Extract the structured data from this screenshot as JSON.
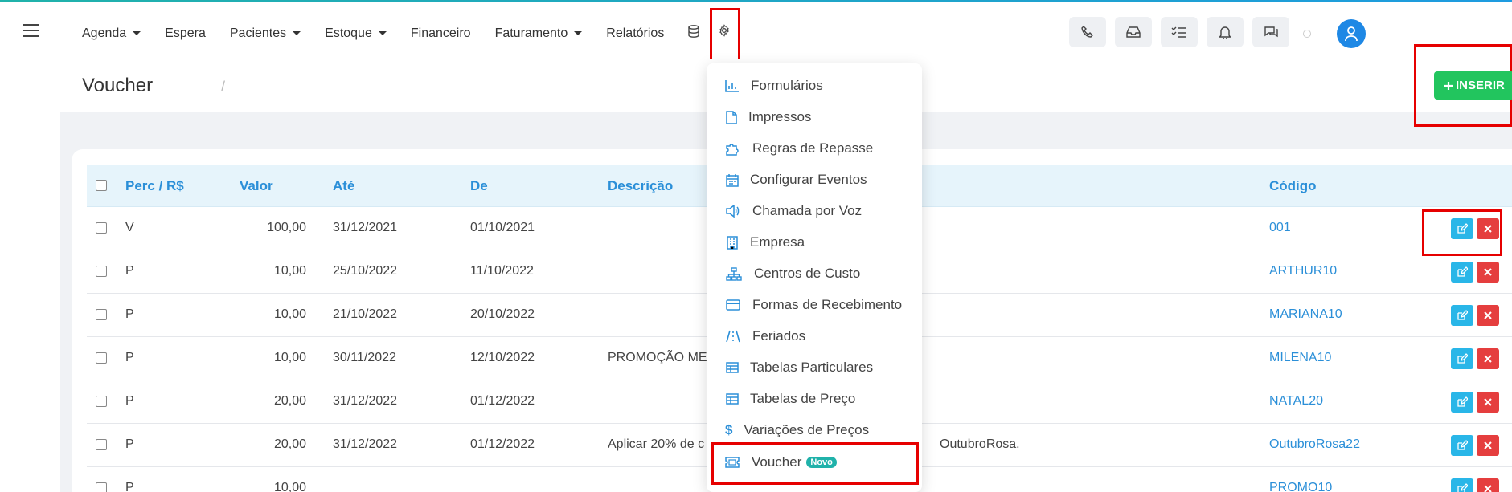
{
  "nav": {
    "items": [
      {
        "label": "Agenda",
        "caret": true
      },
      {
        "label": "Espera",
        "caret": false
      },
      {
        "label": "Pacientes",
        "caret": true
      },
      {
        "label": "Estoque",
        "caret": true
      },
      {
        "label": "Financeiro",
        "caret": false
      },
      {
        "label": "Faturamento",
        "caret": true
      },
      {
        "label": "Relatórios",
        "caret": false
      }
    ],
    "right_icons": [
      "phone-icon",
      "inbox-icon",
      "checklist-icon",
      "bell-icon",
      "chat-icon"
    ]
  },
  "page": {
    "title": "Voucher",
    "breadcrumb_sep": "/",
    "insert_label": "INSERIR"
  },
  "table": {
    "headers": [
      "Perc / R$",
      "Valor",
      "Até",
      "De",
      "Descrição",
      "Código"
    ],
    "rows": [
      {
        "perc": "V",
        "valor": "100,00",
        "ate": "31/12/2021",
        "de": "01/10/2021",
        "descricao": "",
        "codigo": "001"
      },
      {
        "perc": "P",
        "valor": "10,00",
        "ate": "25/10/2022",
        "de": "11/10/2022",
        "descricao": "",
        "codigo": "ARTHUR10"
      },
      {
        "perc": "P",
        "valor": "10,00",
        "ate": "21/10/2022",
        "de": "20/10/2022",
        "descricao": "",
        "codigo": "MARIANA10"
      },
      {
        "perc": "P",
        "valor": "10,00",
        "ate": "30/11/2022",
        "de": "12/10/2022",
        "descricao": "PROMOÇÃO ME",
        "codigo": "MILENA10"
      },
      {
        "perc": "P",
        "valor": "20,00",
        "ate": "31/12/2022",
        "de": "01/12/2022",
        "descricao": "",
        "codigo": "NATAL20"
      },
      {
        "perc": "P",
        "valor": "20,00",
        "ate": "31/12/2022",
        "de": "01/12/2022",
        "descricao": "Aplicar 20% de c",
        "descricao_tail": "OutubroRosa.",
        "codigo": "OutubroRosa22"
      },
      {
        "perc": "P",
        "valor": "10,00",
        "ate": "",
        "de": "",
        "descricao": "",
        "codigo": "PROMO10"
      }
    ]
  },
  "dropdown": {
    "items": [
      {
        "label": "Formulários",
        "icon": "chart-icon"
      },
      {
        "label": "Impressos",
        "icon": "document-icon"
      },
      {
        "label": "Regras de Repasse",
        "icon": "puzzle-icon"
      },
      {
        "label": "Configurar Eventos",
        "icon": "calendar-icon"
      },
      {
        "label": "Chamada por Voz",
        "icon": "speaker-icon"
      },
      {
        "label": "Empresa",
        "icon": "building-icon"
      },
      {
        "label": "Centros de Custo",
        "icon": "sitemap-icon"
      },
      {
        "label": "Formas de Recebimento",
        "icon": "credit-card-icon"
      },
      {
        "label": "Feriados",
        "icon": "road-icon"
      },
      {
        "label": "Tabelas Particulares",
        "icon": "table-icon"
      },
      {
        "label": "Tabelas de Preço",
        "icon": "table-icon"
      },
      {
        "label": "Variações de Preços",
        "icon": "dollar-icon"
      },
      {
        "label": "Voucher",
        "icon": "ticket-icon",
        "badge": "Novo"
      }
    ]
  },
  "colors": {
    "accent": "#2b8fd8",
    "insert": "#22c55e",
    "edit": "#29b6e8",
    "delete": "#e53e3e",
    "highlight": "#e60000"
  }
}
